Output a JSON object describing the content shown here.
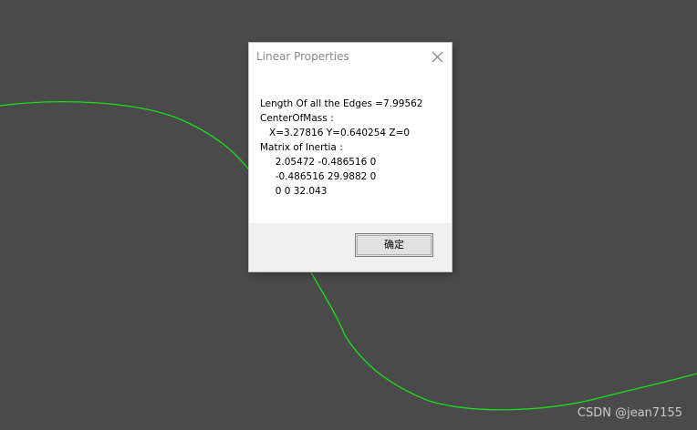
{
  "viewport": {
    "background_color": "#4a4a4a",
    "curve_color": "#19e019"
  },
  "dialog": {
    "title": "Linear Properties",
    "close_icon": "close-icon",
    "lines": [
      "Length Of all the Edges =7.99562",
      "CenterOfMass :",
      "   X=3.27816 Y=0.640254 Z=0",
      "Matrix of Inertia :",
      "     2.05472 -0.486516 0",
      "     -0.486516 29.9882 0",
      "     0 0 32.043"
    ],
    "ok_label": "确定"
  },
  "watermark": "CSDN @jean7155"
}
